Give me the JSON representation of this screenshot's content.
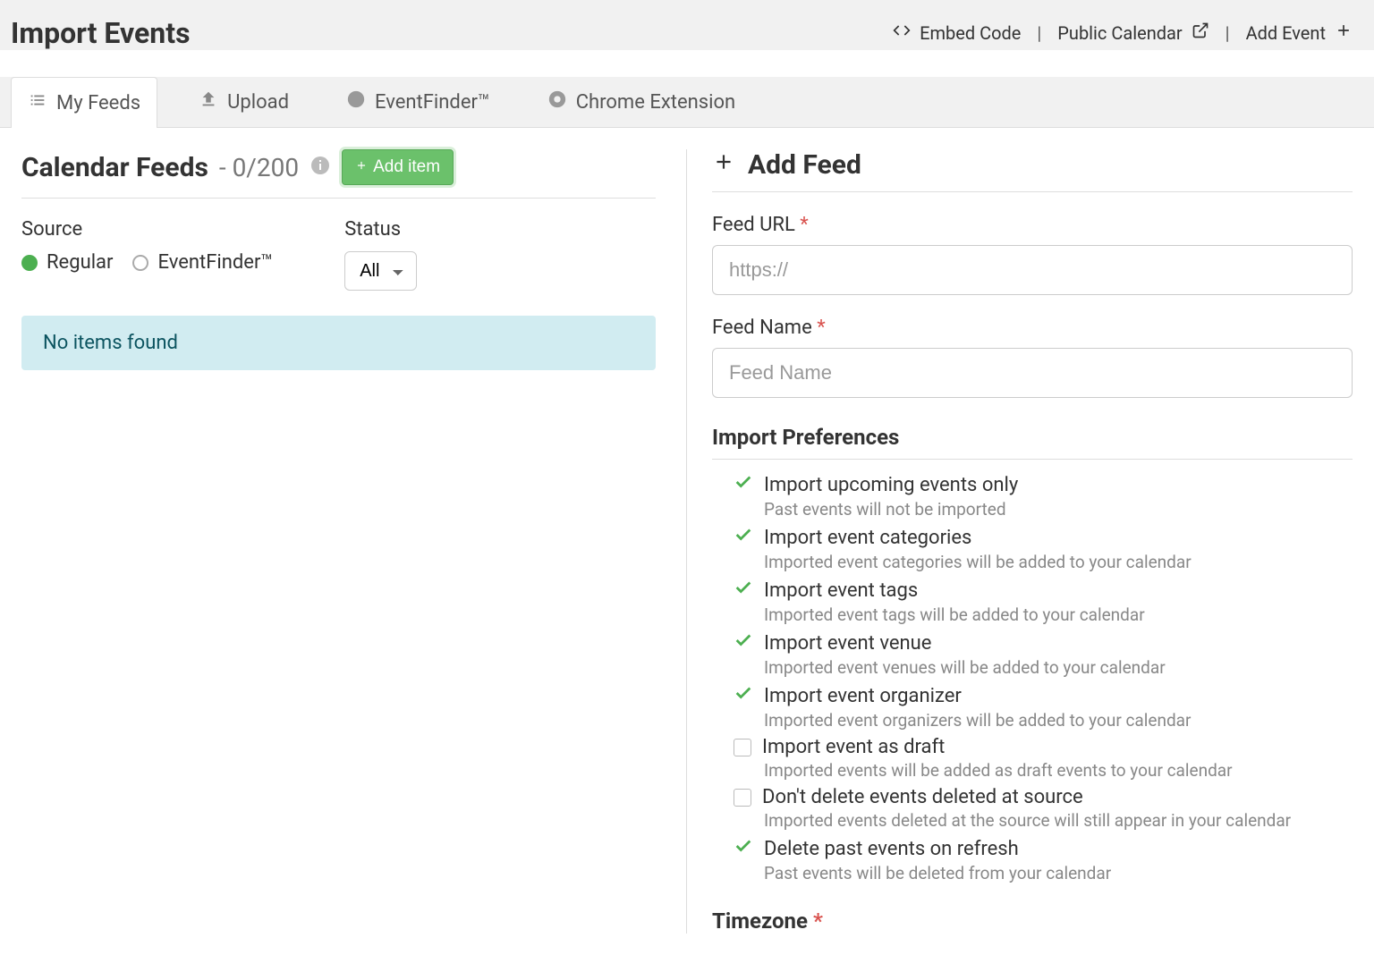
{
  "header": {
    "title": "Import Events",
    "actions": {
      "embed": "Embed Code",
      "public_calendar": "Public Calendar",
      "add_event": "Add Event"
    }
  },
  "tabs": [
    {
      "key": "my-feeds",
      "label": "My Feeds",
      "active": true
    },
    {
      "key": "upload",
      "label": "Upload",
      "active": false
    },
    {
      "key": "eventfinder",
      "label": "EventFinder™",
      "active": false
    },
    {
      "key": "chrome-ext",
      "label": "Chrome Extension",
      "active": false
    }
  ],
  "feeds_panel": {
    "title": "Calendar Feeds",
    "count_text": "- 0/200",
    "add_item_label": "Add item",
    "filters": {
      "source_label": "Source",
      "source_options": {
        "regular": "Regular",
        "eventfinder": "EventFinder™"
      },
      "source_selected": "regular",
      "status_label": "Status",
      "status_selected": "All"
    },
    "empty_message": "No items found"
  },
  "add_feed": {
    "heading": "Add Feed",
    "feed_url_label": "Feed URL",
    "feed_url_placeholder": "https://",
    "feed_url_value": "",
    "feed_name_label": "Feed Name",
    "feed_name_placeholder": "Feed Name",
    "feed_name_value": "",
    "prefs_heading": "Import Preferences",
    "prefs": [
      {
        "key": "upcoming",
        "checked": true,
        "label": "Import upcoming events only",
        "desc": "Past events will not be imported"
      },
      {
        "key": "categories",
        "checked": true,
        "label": "Import event categories",
        "desc": "Imported event categories will be added to your calendar"
      },
      {
        "key": "tags",
        "checked": true,
        "label": "Import event tags",
        "desc": "Imported event tags will be added to your calendar"
      },
      {
        "key": "venue",
        "checked": true,
        "label": "Import event venue",
        "desc": "Imported event venues will be added to your calendar"
      },
      {
        "key": "organizer",
        "checked": true,
        "label": "Import event organizer",
        "desc": "Imported event organizers will be added to your calendar"
      },
      {
        "key": "draft",
        "checked": false,
        "label": "Import event as draft",
        "desc": "Imported events will be added as draft events to your calendar"
      },
      {
        "key": "no-delete",
        "checked": false,
        "label": "Don't delete events deleted at source",
        "desc": "Imported events deleted at the source will still appear in your calendar"
      },
      {
        "key": "delete-past",
        "checked": true,
        "label": "Delete past events on refresh",
        "desc": "Past events will be deleted from your calendar"
      }
    ],
    "timezone_heading": "Timezone"
  }
}
